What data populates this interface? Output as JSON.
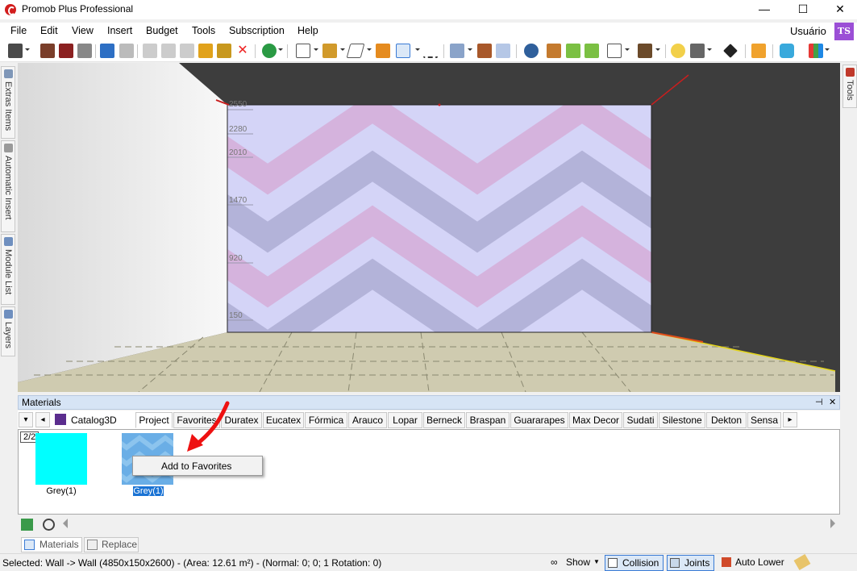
{
  "window": {
    "title": "Promob Plus Professional",
    "minimize": "—",
    "maximize": "☐",
    "close": "✕"
  },
  "menu": {
    "items": [
      "File",
      "Edit",
      "View",
      "Insert",
      "Budget",
      "Tools",
      "Subscription",
      "Help"
    ],
    "user": "Usuário",
    "avatar_initials": "TS"
  },
  "side_tabs": {
    "left": [
      "Extras Items",
      "Automatic Insert",
      "Module List",
      "Layers"
    ],
    "right": [
      "Tools"
    ]
  },
  "viewport": {
    "dimension_labels": [
      "2550",
      "2280",
      "2010",
      "1470",
      "920",
      "150"
    ],
    "wall_pattern": "chevron",
    "colors": {
      "wall_base": "#d4d4f7",
      "stripe_pink": "#d5b3dd",
      "stripe_grey": "#b3b3d9",
      "floor": "#cfcbb0",
      "ceiling": "#3d3d3d"
    }
  },
  "materials": {
    "panel_title": "Materials",
    "pin_icon": "⊣",
    "close_icon": "✕",
    "catalog_label": "Catalog3D",
    "tabs": [
      "Project",
      "Favorites",
      "Duratex",
      "Eucatex",
      "Fórmica",
      "Arauco",
      "Lopar",
      "Berneck",
      "Braspan",
      "Guararapes",
      "Max Decor",
      "Sudati",
      "Silestone",
      "Dekton",
      "Sensa"
    ],
    "active_tab": "Project",
    "page_indicator": "2/2",
    "items": [
      {
        "label": "Grey(1)",
        "color": "#00ffff",
        "selected": false
      },
      {
        "label": "Grey(1)",
        "color": "#6aaee6",
        "selected": true
      }
    ],
    "context_menu": {
      "item": "Add to Favorites"
    },
    "bottom_tabs": [
      "Materials",
      "Replace"
    ]
  },
  "status": {
    "selection_text": "Selected: Wall -> Wall (4850x150x2600) - (Area: 12.61 m²) - (Normal: 0; 0; 1 Rotation: 0)",
    "buttons": [
      {
        "label": "Show",
        "active": false
      },
      {
        "label": "Collision",
        "active": true
      },
      {
        "label": "Joints",
        "active": true
      },
      {
        "label": "Auto Lower",
        "active": false
      }
    ]
  }
}
